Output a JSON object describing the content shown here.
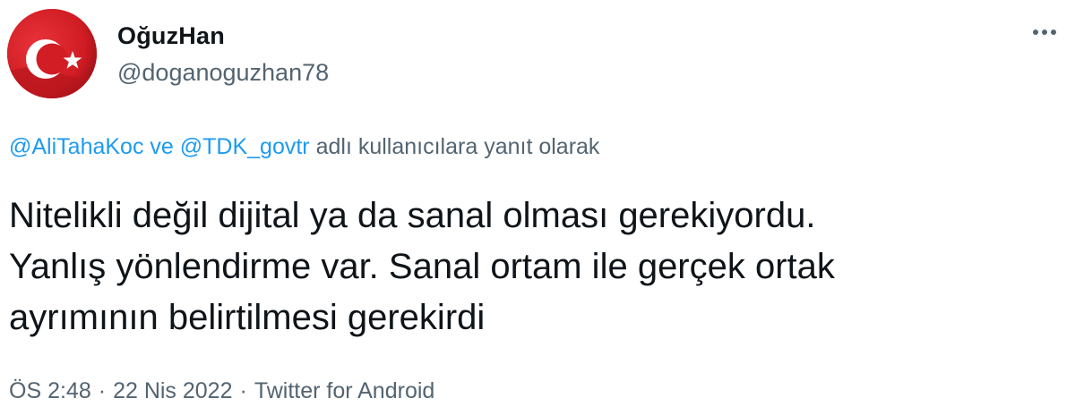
{
  "author": {
    "display_name": "OğuzHan",
    "handle": "@doganoguzhan78",
    "avatar_icon": "turkish-flag-avatar"
  },
  "more_icon": "more-horizontal-icon",
  "reply_context": {
    "mention_1": "@AliTahaKoc",
    "conjunction": "ve",
    "mention_2": "@TDK_govtr",
    "suffix": "adlı kullanıcılara yanıt olarak"
  },
  "tweet": {
    "lines": [
      "Nitelikli değil dijital ya da sanal olması gerekiyordu.",
      "Yanlış yönlendirme var. Sanal ortam ile gerçek ortak",
      "ayrımının belirtilmesi gerekirdi"
    ]
  },
  "meta": {
    "time": "ÖS 2:48",
    "separator": "·",
    "date": "22 Nis 2022",
    "source": "Twitter for Android"
  },
  "colors": {
    "primary_text": "#0f1419",
    "secondary_text": "#536471",
    "link": "#1d9bf0",
    "flag_red": "#d91e24"
  }
}
